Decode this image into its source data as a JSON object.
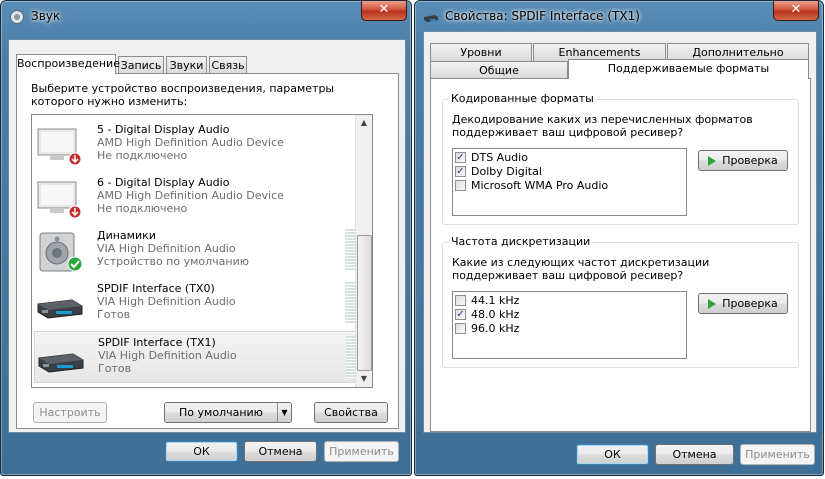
{
  "sound_window": {
    "title": "Звук",
    "close_glyph": "✕",
    "tabs": [
      "Воспроизведение",
      "Запись",
      "Звуки",
      "Связь"
    ],
    "instruction": "Выберите устройство воспроизведения, параметры которого нужно изменить:",
    "devices": [
      {
        "name": "5 - Digital Display Audio",
        "driver": "AMD High Definition Audio Device",
        "status": "Не подключено",
        "icon": "monitor-disconnected-icon"
      },
      {
        "name": "6 - Digital Display Audio",
        "driver": "AMD High Definition Audio Device",
        "status": "Не подключено",
        "icon": "monitor-disconnected-icon"
      },
      {
        "name": "Динамики",
        "driver": "VIA High Definition Audio",
        "status": "Устройство по умолчанию",
        "icon": "speaker-default-icon"
      },
      {
        "name": "SPDIF Interface (TX0)",
        "driver": "VIA High Definition Audio",
        "status": "Готов",
        "icon": "spdif-receiver-icon"
      },
      {
        "name": "SPDIF Interface (TX1)",
        "driver": "VIA High Definition Audio",
        "status": "Готов",
        "icon": "spdif-receiver-icon"
      }
    ],
    "buttons": {
      "configure": "Настроить",
      "default": "По умолчанию",
      "properties": "Свойства"
    },
    "footer": {
      "ok": "ОК",
      "cancel": "Отмена",
      "apply": "Применить"
    }
  },
  "props_window": {
    "title": "Свойства: SPDIF Interface (TX1)",
    "close_glyph": "✕",
    "tabs_row1": [
      "Уровни",
      "Enhancements",
      "Дополнительно"
    ],
    "tabs_row2": [
      "Общие",
      "Поддерживаемые форматы"
    ],
    "encoded_group": {
      "title": "Кодированные форматы",
      "question": "Декодирование каких из перечисленных форматов поддерживает ваш цифровой ресивер?",
      "formats": [
        {
          "label": "DTS Audio",
          "checked": true
        },
        {
          "label": "Dolby Digital",
          "checked": true
        },
        {
          "label": "Microsoft WMA Pro Audio",
          "checked": false
        }
      ],
      "test_button": "Проверка"
    },
    "rate_group": {
      "title": "Частота дискретизации",
      "question": "Какие из следующих частот дискретизации поддерживает ваш цифровой ресивер?",
      "rates": [
        {
          "label": "44.1 kHz",
          "checked": false
        },
        {
          "label": "48.0 kHz",
          "checked": true
        },
        {
          "label": "96.0 kHz",
          "checked": false
        }
      ],
      "test_button": "Проверка"
    },
    "footer": {
      "ok": "ОК",
      "cancel": "Отмена",
      "apply": "Применить"
    }
  },
  "check_glyph": "✓"
}
